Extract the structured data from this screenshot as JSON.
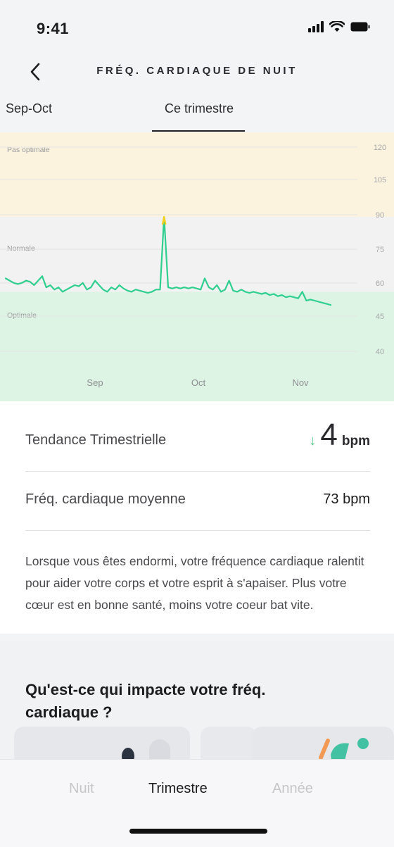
{
  "status_bar": {
    "time": "9:41"
  },
  "header": {
    "title": "FRÉQ. CARDIAQUE DE NUIT",
    "back_icon": "chevron-left-icon"
  },
  "period_tabs": [
    {
      "label": "Sep-Oct",
      "selected": false
    },
    {
      "label": "Ce trimestre",
      "selected": true
    }
  ],
  "chart_data": {
    "type": "line",
    "title": "",
    "xlabel": "",
    "ylabel": "",
    "x_ticks": [
      "Sep",
      "Oct",
      "Nov"
    ],
    "y_ticks": [
      120,
      105,
      90,
      75,
      60,
      45,
      40
    ],
    "zones": [
      {
        "label": "Pas optimale",
        "from": 90,
        "to": 120,
        "color": "#fbf3de"
      },
      {
        "label": "Normale",
        "from": 57,
        "to": 90,
        "color": "#f2f2f2"
      },
      {
        "label": "Optimale",
        "from": 40,
        "to": 57,
        "color": "#ddf4e4"
      }
    ],
    "series": [
      {
        "values": [
          63,
          62,
          61,
          60.5,
          61,
          62,
          61.5,
          60,
          62,
          64,
          59,
          60,
          58,
          59,
          57,
          58,
          59,
          60,
          59.5,
          61,
          58,
          59,
          62,
          60,
          58,
          57,
          59,
          58,
          60,
          58.5,
          57.5,
          57,
          58,
          57.5,
          57,
          56.5,
          57,
          58,
          58,
          86,
          59,
          58.5,
          59,
          58.5,
          59,
          58.5,
          59,
          58.5,
          58,
          63,
          59,
          58,
          60,
          57,
          58,
          62,
          57.5,
          57,
          58,
          57,
          56.5,
          57,
          56.5,
          56,
          56.5,
          55.5,
          56,
          55,
          55.5,
          54.5,
          55,
          54.5,
          54,
          57,
          53,
          53.5,
          53,
          52.5,
          52,
          51.5,
          51
        ],
        "spike_peak": 90
      }
    ]
  },
  "stats": {
    "trend": {
      "label": "Tendance Trimestrielle",
      "arrow": "↓",
      "value": "4",
      "unit": "bpm"
    },
    "average": {
      "label": "Fréq. cardiaque moyenne",
      "value": "73 bpm"
    }
  },
  "description": "Lorsque vous êtes endormi, votre fréquence cardiaque ralentit pour aider votre corps et votre esprit à s'apaiser. Plus votre cœur est en bonne santé, moins votre coeur bat vite.",
  "impact": {
    "title": "Qu'est-ce qui impacte votre fréq. cardiaque ?"
  },
  "bottom_tabs": [
    {
      "label": "Nuit",
      "selected": false
    },
    {
      "label": "Trimestre",
      "selected": true
    },
    {
      "label": "Année",
      "selected": false
    }
  ]
}
